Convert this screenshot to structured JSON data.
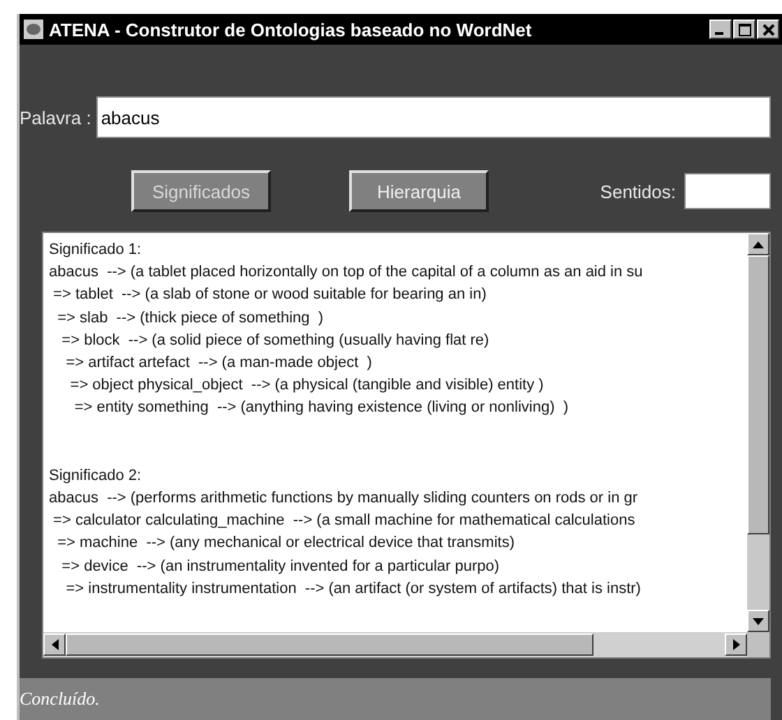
{
  "window": {
    "title": "ATENA - Construtor de Ontologias baseado no WordNet"
  },
  "word_field": {
    "label": "Palavra :",
    "value": "abacus"
  },
  "buttons": [
    "Significados",
    "Hierarquia"
  ],
  "senses_field": {
    "label": "Sentidos:"
  },
  "meanings": [
    {
      "lines": [
        "Significado 1:",
        "abacus  --> (a tablet placed horizontally on top of the capital of a column as an aid in su",
        " => tablet  --> (a slab of stone or wood suitable for bearing an in)",
        "  => slab  --> (thick piece of something  )",
        "   => block  --> (a solid piece of something (usually having flat re)",
        "    => artifact artefact  --> (a man-made object  )",
        "     => object physical_object  --> (a physical (tangible and visible) entity )",
        "      => entity something  --> (anything having existence (living or nonliving)  )"
      ]
    },
    {
      "lines": [
        "Significado 2:",
        "abacus  --> (performs arithmetic functions by manually sliding counters on rods or in gr",
        " => calculator calculating_machine  --> (a small machine for mathematical calculations",
        "  => machine  --> (any mechanical or electrical device that transmits)",
        "   => device  --> (an instrumentality invented for a particular purpo)",
        "    => instrumentality instrumentation  --> (an artifact (or system of artifacts) that is instr)"
      ]
    }
  ],
  "status_bar": "Concluído."
}
